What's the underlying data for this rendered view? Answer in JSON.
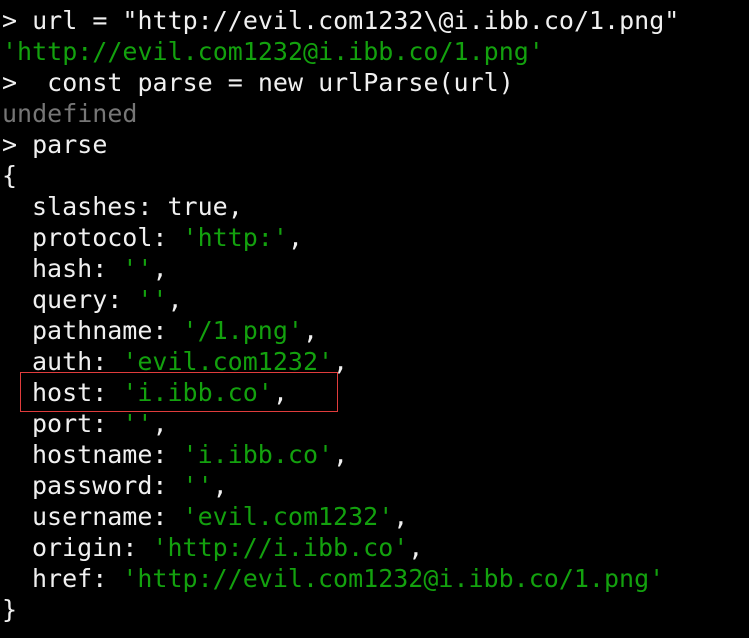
{
  "terminal": {
    "lines": [
      {
        "prompt": "> ",
        "text": "url = \"http://evil.com1232\\@i.ibb.co/1.png\""
      },
      {
        "text": "'http://evil.com1232@i.ibb.co/1.png'"
      },
      {
        "prompt": "> ",
        "text": " const parse = new urlParse(url)"
      },
      {
        "text": "undefined"
      },
      {
        "prompt": "> ",
        "text": "parse"
      },
      {
        "text": "{"
      }
    ],
    "properties": [
      {
        "key": "slashes",
        "value": "true",
        "type": "literal"
      },
      {
        "key": "protocol",
        "value": "'http:'",
        "type": "string"
      },
      {
        "key": "hash",
        "value": "''",
        "type": "string"
      },
      {
        "key": "query",
        "value": "''",
        "type": "string"
      },
      {
        "key": "pathname",
        "value": "'/1.png'",
        "type": "string"
      },
      {
        "key": "auth",
        "value": "'evil.com1232'",
        "type": "string"
      },
      {
        "key": "host",
        "value": "'i.ibb.co'",
        "type": "string",
        "highlighted": true
      },
      {
        "key": "port",
        "value": "''",
        "type": "string"
      },
      {
        "key": "hostname",
        "value": "'i.ibb.co'",
        "type": "string"
      },
      {
        "key": "password",
        "value": "''",
        "type": "string"
      },
      {
        "key": "username",
        "value": "'evil.com1232'",
        "type": "string"
      },
      {
        "key": "origin",
        "value": "'http://i.ibb.co'",
        "type": "string"
      },
      {
        "key": "href",
        "value": "'http://evil.com1232@i.ibb.co/1.png'",
        "type": "string"
      }
    ],
    "closing": "}"
  },
  "colors": {
    "background": "#000000",
    "text": "#f0f0f0",
    "string": "#13a10e",
    "undefined": "#767676",
    "highlight_border": "#e03c3c"
  }
}
